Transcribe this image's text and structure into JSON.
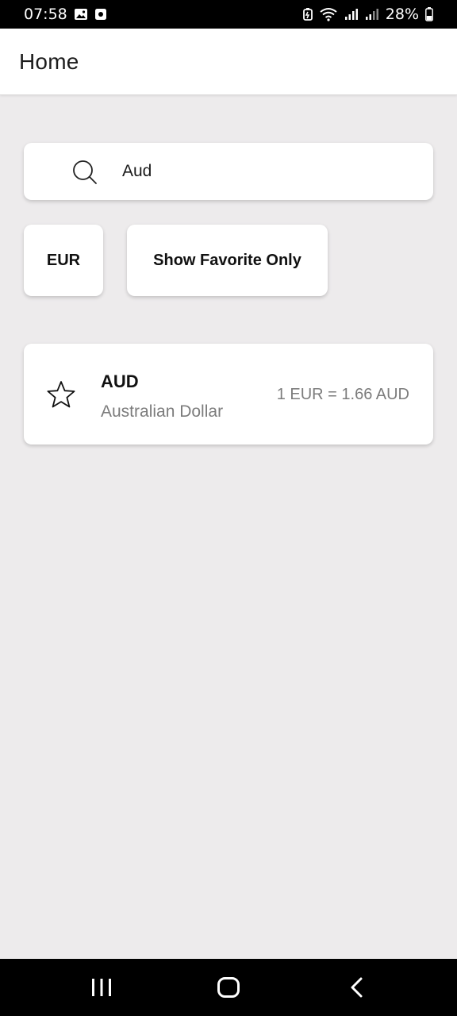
{
  "status_bar": {
    "time": "07:58",
    "battery": "28%",
    "icons": [
      "gallery-icon",
      "notification-icon",
      "battery-saver-icon",
      "wifi-icon",
      "signal-icon",
      "signal-icon",
      "battery-icon"
    ]
  },
  "app_bar": {
    "title": "Home"
  },
  "search": {
    "value": "Aud",
    "icon": "search-icon"
  },
  "filters": {
    "base_currency": "EUR",
    "favorite_toggle": "Show Favorite Only"
  },
  "currencies": [
    {
      "code": "AUD",
      "name": "Australian Dollar",
      "rate": "1 EUR = 1.66 AUD",
      "favorite": false,
      "icon": "star-outline-icon"
    }
  ],
  "nav": {
    "icons": [
      "recents-icon",
      "home-icon",
      "back-icon"
    ]
  },
  "colors": {
    "background": "#edebec",
    "surface": "#ffffff",
    "secondary_text": "#7c7c7c",
    "system_bar": "#000000"
  }
}
